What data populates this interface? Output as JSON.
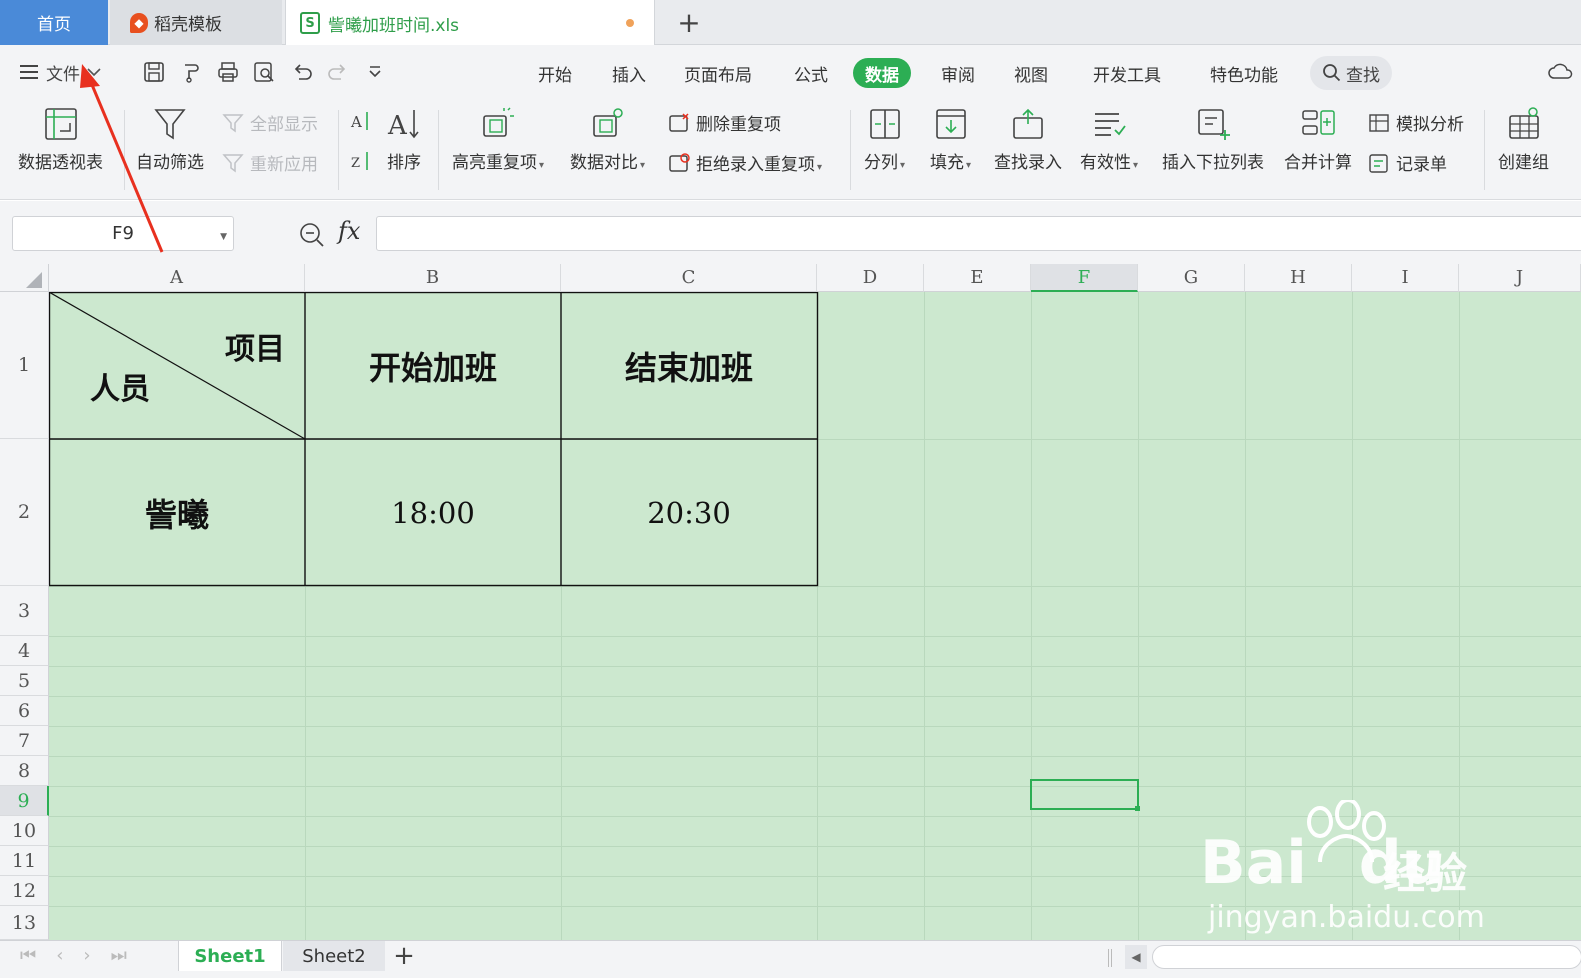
{
  "tabs": {
    "home": "首页",
    "template": "稻壳模板",
    "file": "訾曦加班时间.xls",
    "new_tab": "+"
  },
  "menu": {
    "file_label": "文件",
    "tabs": [
      "开始",
      "插入",
      "页面布局",
      "公式",
      "数据",
      "审阅",
      "视图",
      "开发工具",
      "特色功能"
    ],
    "active_tab": "数据",
    "search_label": "查找"
  },
  "ribbon": {
    "pivot": "数据透视表",
    "autofilter": "自动筛选",
    "show_all": "全部显示",
    "reapply": "重新应用",
    "sort": "排序",
    "highlight_dup": "高亮重复项",
    "compare": "数据对比",
    "remove_dup": "删除重复项",
    "reject_dup": "拒绝录入重复项",
    "split": "分列",
    "fill": "填充",
    "find_entry": "查找录入",
    "validity": "有效性",
    "insert_dropdown": "插入下拉列表",
    "consolidate": "合并计算",
    "whatif": "模拟分析",
    "record_form": "记录单",
    "create_group": "创建组"
  },
  "formula_bar": {
    "name_box": "F9",
    "fx": "fx",
    "value": ""
  },
  "grid": {
    "columns": [
      "A",
      "B",
      "C",
      "D",
      "E",
      "F",
      "G",
      "H",
      "I",
      "J"
    ],
    "rows": [
      "1",
      "2",
      "3",
      "4",
      "5",
      "6",
      "7",
      "8",
      "9",
      "10",
      "11",
      "12",
      "13"
    ],
    "active_cell": "F9",
    "a1_top": "项目",
    "a1_bottom": "人员",
    "b1": "开始加班",
    "c1": "结束加班",
    "a2": "訾曦",
    "b2": "18:00",
    "c2": "20:30",
    "cell_fill": "#cce8cf"
  },
  "sheets": {
    "tabs": [
      "Sheet1",
      "Sheet2"
    ],
    "active": "Sheet1",
    "add": "+"
  },
  "watermark": {
    "brand": "Bai",
    "brand2": "du",
    "cn": "经验",
    "url": "jingyan.baidu.com"
  },
  "colors": {
    "accent_green": "#2cae54",
    "tab_blue": "#4a8ad8",
    "annotation_red": "#e8301f"
  }
}
